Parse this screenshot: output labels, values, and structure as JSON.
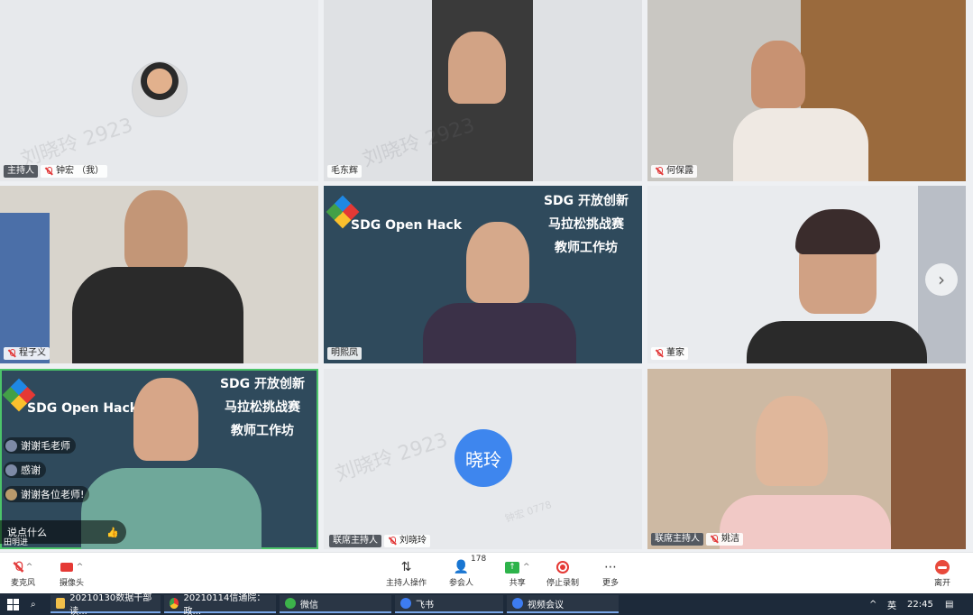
{
  "tiles": [
    {
      "id": "zhong",
      "name": "钟宏 （我）",
      "role": "主持人",
      "muted": true
    },
    {
      "id": "mao",
      "name": "毛东辉",
      "role": "",
      "muted": false
    },
    {
      "id": "he",
      "name": "何保露",
      "role": "",
      "muted": true
    },
    {
      "id": "cheng",
      "name": "程子义",
      "role": "",
      "muted": true
    },
    {
      "id": "ming",
      "name": "明熙凤",
      "role": "",
      "muted": false
    },
    {
      "id": "dong",
      "name": "董家",
      "role": "",
      "muted": true
    },
    {
      "id": "tian",
      "name": "田明进",
      "role": "",
      "muted": false
    },
    {
      "id": "liu",
      "name": "刘晓玲",
      "role": "联席主持人",
      "muted": true,
      "avatar_text": "晓玲"
    },
    {
      "id": "yao",
      "name": "姚洁",
      "role": "联席主持人",
      "muted": true
    }
  ],
  "watermark": "刘晓玲 2923",
  "watermark_small": "钟宏 0778",
  "slide": {
    "brand": "SDG Open Hack",
    "title_lines": [
      "SDG 开放创新",
      "马拉松挑战赛",
      "教师工作坊"
    ]
  },
  "chat": {
    "messages": [
      "谢谢毛老师",
      "感谢",
      "谢谢各位老师!"
    ],
    "input_placeholder": "说点什么"
  },
  "toolbar": {
    "mic": "麦克风",
    "camera": "摄像头",
    "host_ops": "主持人操作",
    "participants": "参会人",
    "participants_count": "178",
    "share": "共享",
    "stop_record": "停止录制",
    "more": "更多",
    "leave": "离开"
  },
  "taskbar": {
    "items": [
      "20210130数据干部读...",
      "20210114信通院：政...",
      "微信",
      "飞书",
      "视频会议"
    ],
    "ime": "英",
    "time": "22:45",
    "up_arrow": "^"
  }
}
